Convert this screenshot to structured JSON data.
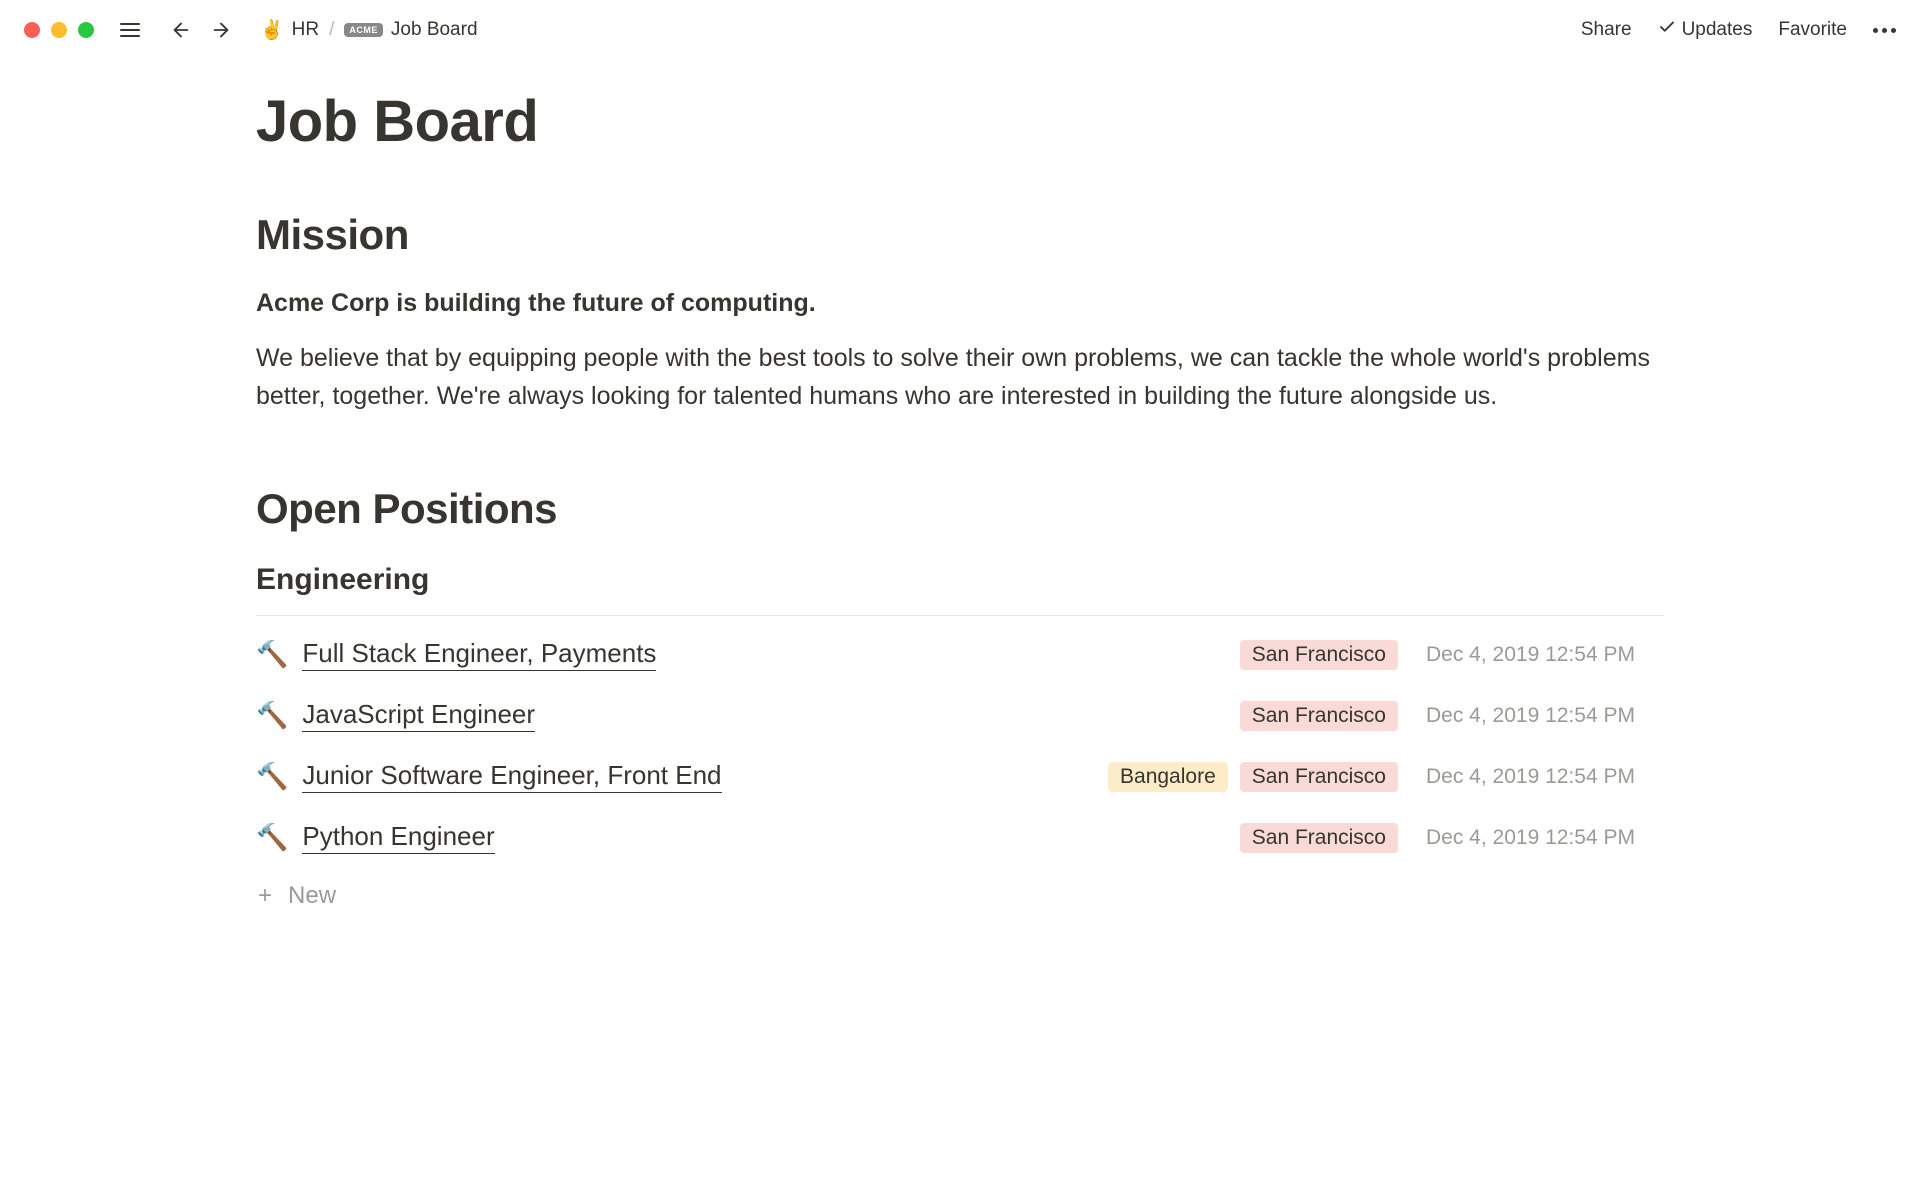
{
  "toolbar": {
    "breadcrumb": {
      "hr_icon": "✌️",
      "hr_label": "HR",
      "acme_badge": "ACME",
      "board_label": "Job Board"
    },
    "actions": {
      "share": "Share",
      "updates": "Updates",
      "favorite": "Favorite"
    }
  },
  "page": {
    "title": "Job Board",
    "mission": {
      "heading": "Mission",
      "bold": "Acme Corp is building the future of computing.",
      "body": "We believe that by equipping people with the best tools to solve their own problems, we can tackle the whole world's problems better, together. We're always looking for talented humans who are interested in building the future alongside us."
    },
    "open_positions": {
      "heading": "Open Positions",
      "engineering": {
        "heading": "Engineering",
        "rows": [
          {
            "icon": "🔨",
            "title": "Full Stack Engineer, Payments",
            "tags": [
              {
                "label": "San Francisco",
                "class": "tag-sf"
              }
            ],
            "date": "Dec 4, 2019 12:54 PM"
          },
          {
            "icon": "🔨",
            "title": "JavaScript Engineer",
            "tags": [
              {
                "label": "San Francisco",
                "class": "tag-sf"
              }
            ],
            "date": "Dec 4, 2019 12:54 PM"
          },
          {
            "icon": "🔨",
            "title": "Junior Software Engineer, Front End",
            "tags": [
              {
                "label": "Bangalore",
                "class": "tag-bangalore"
              },
              {
                "label": "San Francisco",
                "class": "tag-sf"
              }
            ],
            "date": "Dec 4, 2019 12:54 PM"
          },
          {
            "icon": "🔨",
            "title": "Python Engineer",
            "tags": [
              {
                "label": "San Francisco",
                "class": "tag-sf"
              }
            ],
            "date": "Dec 4, 2019 12:54 PM"
          }
        ],
        "new_label": "New"
      }
    }
  }
}
